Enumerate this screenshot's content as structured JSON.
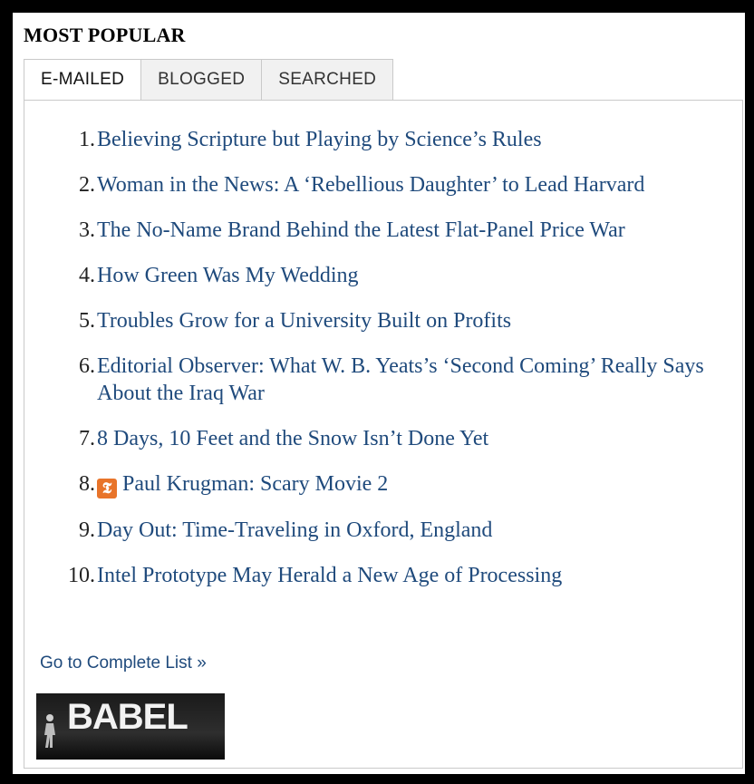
{
  "section": {
    "title": "MOST POPULAR"
  },
  "tabs": [
    {
      "label": "E-MAILED",
      "active": true
    },
    {
      "label": "BLOGGED",
      "active": false
    },
    {
      "label": "SEARCHED",
      "active": false
    }
  ],
  "articles": [
    {
      "rank": "1.",
      "title": "Believing Scripture but Playing by Science’s Rules"
    },
    {
      "rank": "2.",
      "title": "Woman in the News: A ‘Rebellious Daughter’ to Lead Harvard"
    },
    {
      "rank": "3.",
      "title": "The No-Name Brand Behind the Latest Flat-Panel Price War"
    },
    {
      "rank": "4.",
      "title": "How Green Was My Wedding"
    },
    {
      "rank": "5.",
      "title": "Troubles Grow for a University Built on Profits"
    },
    {
      "rank": "6.",
      "title": "Editorial Observer: What W. B. Yeats’s ‘Second Coming’ Really Says About the Iraq War"
    },
    {
      "rank": "7.",
      "title": "8 Days, 10 Feet and the Snow Isn’t Done Yet"
    },
    {
      "rank": "8.",
      "title": "Paul Krugman: Scary Movie 2",
      "icon": "times-select-icon"
    },
    {
      "rank": "9.",
      "title": "Day Out: Time-Traveling in Oxford, England"
    },
    {
      "rank": "10.",
      "title": "Intel Prototype May Herald a New Age of Processing"
    }
  ],
  "footer": {
    "complete_list": "Go to Complete List »"
  },
  "promo": {
    "label": "BABEL"
  },
  "colors": {
    "link": "#1f4a7c",
    "badge": "#e8742a",
    "tab_bg": "#f1f1f1"
  }
}
